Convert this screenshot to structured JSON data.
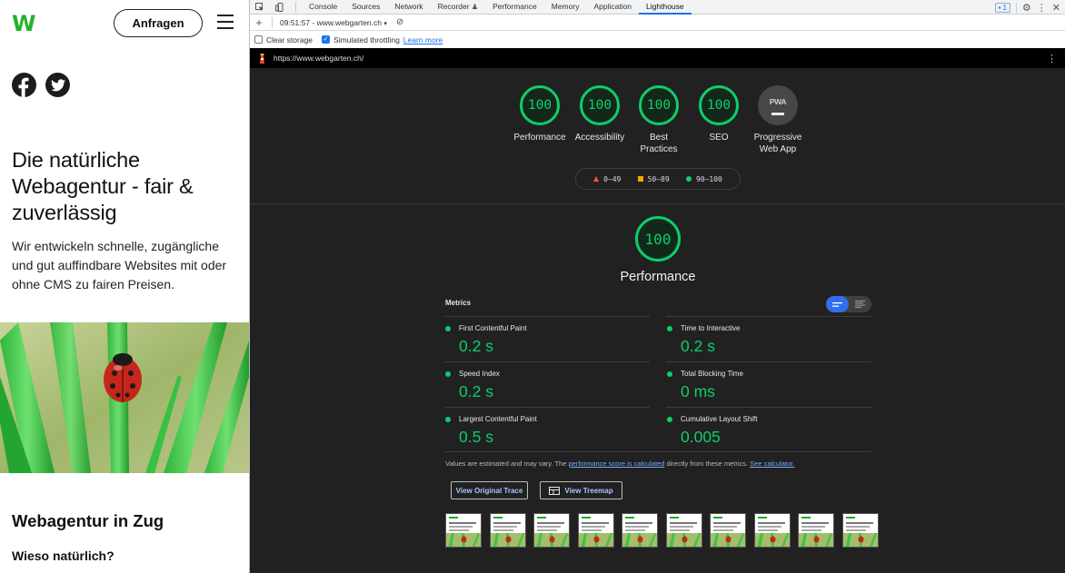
{
  "site": {
    "logo": "W",
    "cta_label": "Anfragen",
    "social": [
      {
        "icon": "facebook-icon"
      },
      {
        "icon": "twitter-icon"
      }
    ],
    "hero_title": "Die natürliche Webagentur - fair & zuverlässig",
    "hero_text": "Wir entwickeln schnelle, zugängliche und gut auffindbare Websites mit oder ohne CMS zu fairen Preisen.",
    "section_title": "Webagentur in Zug",
    "section_subtitle": "Wieso natürlich?",
    "brand_color": "#26b12d"
  },
  "devtools": {
    "tabs": [
      "Console",
      "Sources",
      "Network",
      "Recorder",
      "Performance",
      "Memory",
      "Application",
      "Lighthouse"
    ],
    "active_tab": "Lighthouse",
    "issues_count": "1",
    "report_select": "09:51:57 - www.webgarten.ch",
    "clear_storage_label": "Clear storage",
    "throttling_label": "Simulated throttling",
    "learn_more": "Learn more",
    "url": "https://www.webgarten.ch/"
  },
  "lighthouse": {
    "scores": [
      {
        "label": "Performance",
        "value": "100"
      },
      {
        "label": "Accessibility",
        "value": "100"
      },
      {
        "label": "Best Practices",
        "value": "100"
      },
      {
        "label": "SEO",
        "value": "100"
      }
    ],
    "pwa": {
      "badge": "PWA",
      "label": "Progressive Web App"
    },
    "legend": [
      {
        "range": "0–49",
        "color": "#ff4e42"
      },
      {
        "range": "50–89",
        "color": "#ffa400"
      },
      {
        "range": "90–100",
        "color": "#0cce6b"
      }
    ],
    "performance_score": "100",
    "performance_title": "Performance",
    "metrics_label": "Metrics",
    "metrics": [
      {
        "name": "First Contentful Paint",
        "value": "0.2 s"
      },
      {
        "name": "Time to Interactive",
        "value": "0.2 s"
      },
      {
        "name": "Speed Index",
        "value": "0.2 s"
      },
      {
        "name": "Total Blocking Time",
        "value": "0 ms"
      },
      {
        "name": "Largest Contentful Paint",
        "value": "0.5 s"
      },
      {
        "name": "Cumulative Layout Shift",
        "value": "0.005"
      }
    ],
    "note_prefix": "Values are estimated and may vary. The ",
    "note_link1": "performance score is calculated",
    "note_middle": " directly from these metrics. ",
    "note_link2": "See calculator.",
    "view_trace": "View Original Trace",
    "view_treemap": "View Treemap",
    "good_color": "#0cce6b"
  }
}
